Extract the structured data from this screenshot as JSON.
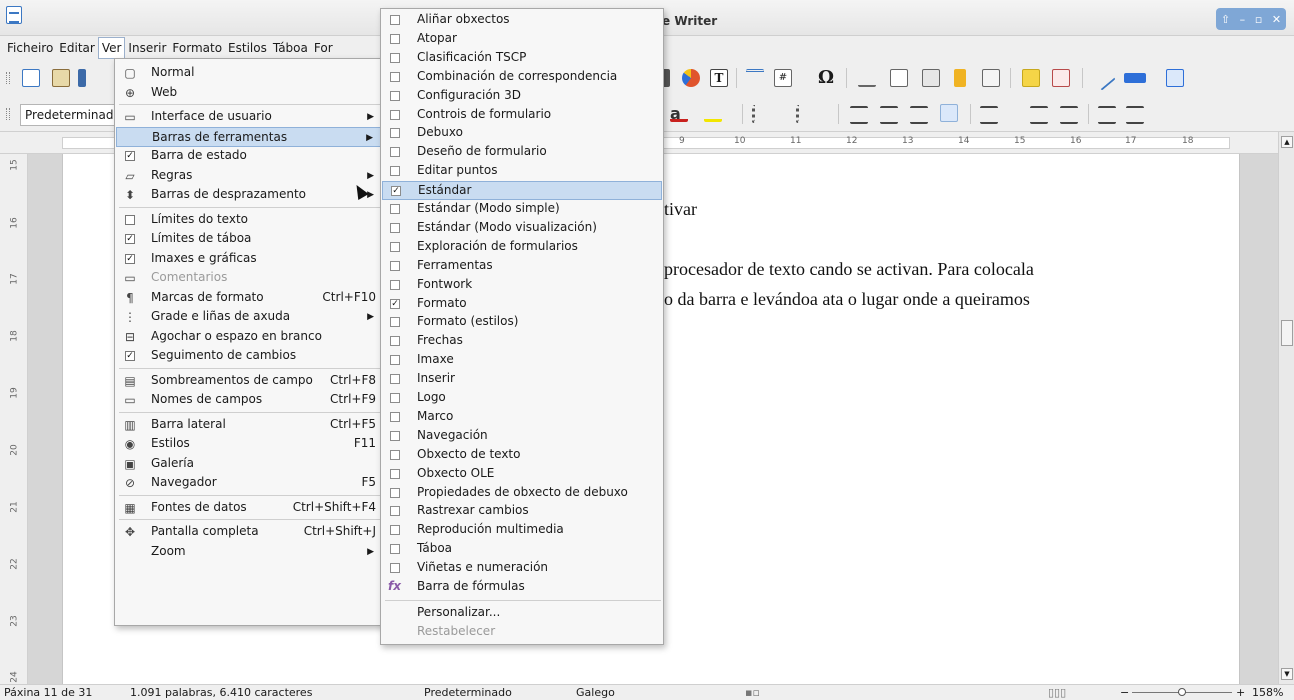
{
  "window": {
    "title": "e Writer"
  },
  "menubar": [
    "Ficheiro",
    "Editar",
    "Ver",
    "Inserir",
    "Formato",
    "Estilos",
    "Táboa",
    "For"
  ],
  "stylebox": "Predeterminad",
  "ruler_numbers": [
    "9",
    "10",
    "11",
    "12",
    "13",
    "14",
    "15",
    "16",
    "17",
    "18"
  ],
  "vruler_numbers": [
    "15",
    "16",
    "17",
    "18",
    "19",
    "20",
    "21",
    "22",
    "23",
    "24"
  ],
  "document": {
    "line1": "tivar",
    "line2": "procesador de texto cando se activan. Para colocala",
    "line3": "o da barra e levándoa ata o lugar onde a queiramos"
  },
  "ver_menu": [
    {
      "label": "Normal",
      "icon": "page-icon"
    },
    {
      "label": "Web",
      "icon": "globe-icon"
    },
    {
      "sep": true
    },
    {
      "label": "Interface de usuario",
      "icon": "interface-icon",
      "sub": true
    },
    {
      "label": "Barras de ferramentas",
      "sub": true,
      "hl": true
    },
    {
      "label": "Barra de estado",
      "check": true
    },
    {
      "label": "Regras",
      "icon": "ruler-icon",
      "sub": true
    },
    {
      "label": "Barras de desprazamento",
      "icon": "scrollbars-icon",
      "sub": true
    },
    {
      "sep": true
    },
    {
      "label": "Límites do texto",
      "check": false
    },
    {
      "label": "Límites de táboa",
      "check": true
    },
    {
      "label": "Imaxes e gráficas",
      "check": true
    },
    {
      "label": "Comentarios",
      "icon": "comment-icon",
      "disabled": true
    },
    {
      "label": "Marcas de formato",
      "icon": "pilcrow-icon",
      "shortcut": "Ctrl+F10"
    },
    {
      "label": "Grade e liñas de axuda",
      "icon": "grid-icon",
      "sub": true
    },
    {
      "label": "Agochar o espazo en branco",
      "icon": "whitespace-icon"
    },
    {
      "label": "Seguimento de cambios",
      "check": true
    },
    {
      "sep": true
    },
    {
      "label": "Sombreamentos de campo",
      "icon": "field-shading-icon",
      "shortcut": "Ctrl+F8"
    },
    {
      "label": "Nomes de campos",
      "icon": "field-names-icon",
      "shortcut": "Ctrl+F9"
    },
    {
      "sep": true
    },
    {
      "label": "Barra lateral",
      "icon": "sidebar-icon",
      "shortcut": "Ctrl+F5"
    },
    {
      "label": "Estilos",
      "icon": "styles-icon",
      "shortcut": "F11"
    },
    {
      "label": "Galería",
      "icon": "gallery-icon"
    },
    {
      "label": "Navegador",
      "icon": "navigator-icon",
      "shortcut": "F5"
    },
    {
      "sep": true
    },
    {
      "label": "Fontes de datos",
      "icon": "datasource-icon",
      "shortcut": "Ctrl+Shift+F4"
    },
    {
      "sep": true
    },
    {
      "label": "Pantalla completa",
      "icon": "fullscreen-icon",
      "shortcut": "Ctrl+Shift+J"
    },
    {
      "label": "Zoom",
      "sub": true
    }
  ],
  "toolbars_menu": [
    {
      "label": "Aliñar obxectos",
      "check": false
    },
    {
      "label": "Atopar",
      "check": false
    },
    {
      "label": "Clasificación TSCP",
      "check": false
    },
    {
      "label": "Combinación de correspondencia",
      "check": false
    },
    {
      "label": "Configuración 3D",
      "check": false
    },
    {
      "label": "Controis de formulario",
      "check": false
    },
    {
      "label": "Debuxo",
      "check": false
    },
    {
      "label": "Deseño de formulario",
      "check": false
    },
    {
      "label": "Editar puntos",
      "check": false
    },
    {
      "label": "Estándar",
      "check": true,
      "hl": true
    },
    {
      "label": "Estándar (Modo simple)",
      "check": false
    },
    {
      "label": "Estándar (Modo visualización)",
      "check": false
    },
    {
      "label": "Exploración de formularios",
      "check": false
    },
    {
      "label": "Ferramentas",
      "check": false
    },
    {
      "label": "Fontwork",
      "check": false
    },
    {
      "label": "Formato",
      "check": true
    },
    {
      "label": "Formato (estilos)",
      "check": false
    },
    {
      "label": "Frechas",
      "check": false
    },
    {
      "label": "Imaxe",
      "check": false
    },
    {
      "label": "Inserir",
      "check": false
    },
    {
      "label": "Logo",
      "check": false
    },
    {
      "label": "Marco",
      "check": false
    },
    {
      "label": "Navegación",
      "check": false
    },
    {
      "label": "Obxecto de texto",
      "check": false
    },
    {
      "label": "Obxecto OLE",
      "check": false
    },
    {
      "label": "Propiedades de obxecto de debuxo",
      "check": false
    },
    {
      "label": "Rastrexar cambios",
      "check": false
    },
    {
      "label": "Reprodución multimedia",
      "check": false
    },
    {
      "label": "Táboa",
      "check": false
    },
    {
      "label": "Viñetas e numeración",
      "check": false
    },
    {
      "label": "Barra de fórmulas",
      "icon": "formula-icon"
    },
    {
      "sep": true
    },
    {
      "label": "Personalizar...",
      "plain": true
    },
    {
      "label": "Restabelecer",
      "plain": true,
      "disabled": true
    }
  ],
  "statusbar": {
    "page": "Páxina 11 de 31",
    "words": "1.091 palabras, 6.410 caracteres",
    "style": "Predeterminado",
    "lang": "Galego",
    "zoom": "158%"
  },
  "zoom_level": 1.58
}
